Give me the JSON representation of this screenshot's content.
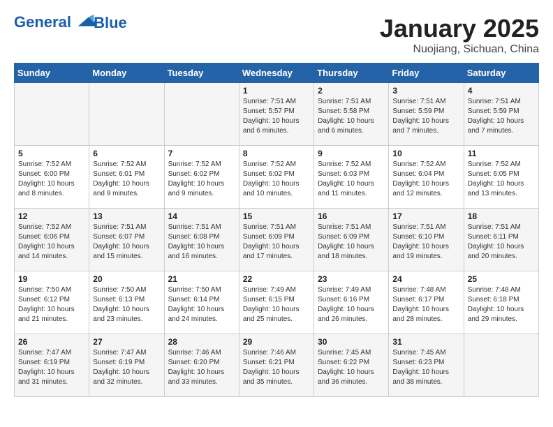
{
  "logo": {
    "line1": "General",
    "line2": "Blue"
  },
  "title": "January 2025",
  "subtitle": "Nuojiang, Sichuan, China",
  "days_of_week": [
    "Sunday",
    "Monday",
    "Tuesday",
    "Wednesday",
    "Thursday",
    "Friday",
    "Saturday"
  ],
  "weeks": [
    [
      {
        "day": "",
        "info": ""
      },
      {
        "day": "",
        "info": ""
      },
      {
        "day": "",
        "info": ""
      },
      {
        "day": "1",
        "info": "Sunrise: 7:51 AM\nSunset: 5:57 PM\nDaylight: 10 hours\nand 6 minutes."
      },
      {
        "day": "2",
        "info": "Sunrise: 7:51 AM\nSunset: 5:58 PM\nDaylight: 10 hours\nand 6 minutes."
      },
      {
        "day": "3",
        "info": "Sunrise: 7:51 AM\nSunset: 5:59 PM\nDaylight: 10 hours\nand 7 minutes."
      },
      {
        "day": "4",
        "info": "Sunrise: 7:51 AM\nSunset: 5:59 PM\nDaylight: 10 hours\nand 7 minutes."
      }
    ],
    [
      {
        "day": "5",
        "info": "Sunrise: 7:52 AM\nSunset: 6:00 PM\nDaylight: 10 hours\nand 8 minutes."
      },
      {
        "day": "6",
        "info": "Sunrise: 7:52 AM\nSunset: 6:01 PM\nDaylight: 10 hours\nand 9 minutes."
      },
      {
        "day": "7",
        "info": "Sunrise: 7:52 AM\nSunset: 6:02 PM\nDaylight: 10 hours\nand 9 minutes."
      },
      {
        "day": "8",
        "info": "Sunrise: 7:52 AM\nSunset: 6:02 PM\nDaylight: 10 hours\nand 10 minutes."
      },
      {
        "day": "9",
        "info": "Sunrise: 7:52 AM\nSunset: 6:03 PM\nDaylight: 10 hours\nand 11 minutes."
      },
      {
        "day": "10",
        "info": "Sunrise: 7:52 AM\nSunset: 6:04 PM\nDaylight: 10 hours\nand 12 minutes."
      },
      {
        "day": "11",
        "info": "Sunrise: 7:52 AM\nSunset: 6:05 PM\nDaylight: 10 hours\nand 13 minutes."
      }
    ],
    [
      {
        "day": "12",
        "info": "Sunrise: 7:52 AM\nSunset: 6:06 PM\nDaylight: 10 hours\nand 14 minutes."
      },
      {
        "day": "13",
        "info": "Sunrise: 7:51 AM\nSunset: 6:07 PM\nDaylight: 10 hours\nand 15 minutes."
      },
      {
        "day": "14",
        "info": "Sunrise: 7:51 AM\nSunset: 6:08 PM\nDaylight: 10 hours\nand 16 minutes."
      },
      {
        "day": "15",
        "info": "Sunrise: 7:51 AM\nSunset: 6:09 PM\nDaylight: 10 hours\nand 17 minutes."
      },
      {
        "day": "16",
        "info": "Sunrise: 7:51 AM\nSunset: 6:09 PM\nDaylight: 10 hours\nand 18 minutes."
      },
      {
        "day": "17",
        "info": "Sunrise: 7:51 AM\nSunset: 6:10 PM\nDaylight: 10 hours\nand 19 minutes."
      },
      {
        "day": "18",
        "info": "Sunrise: 7:51 AM\nSunset: 6:11 PM\nDaylight: 10 hours\nand 20 minutes."
      }
    ],
    [
      {
        "day": "19",
        "info": "Sunrise: 7:50 AM\nSunset: 6:12 PM\nDaylight: 10 hours\nand 21 minutes."
      },
      {
        "day": "20",
        "info": "Sunrise: 7:50 AM\nSunset: 6:13 PM\nDaylight: 10 hours\nand 23 minutes."
      },
      {
        "day": "21",
        "info": "Sunrise: 7:50 AM\nSunset: 6:14 PM\nDaylight: 10 hours\nand 24 minutes."
      },
      {
        "day": "22",
        "info": "Sunrise: 7:49 AM\nSunset: 6:15 PM\nDaylight: 10 hours\nand 25 minutes."
      },
      {
        "day": "23",
        "info": "Sunrise: 7:49 AM\nSunset: 6:16 PM\nDaylight: 10 hours\nand 26 minutes."
      },
      {
        "day": "24",
        "info": "Sunrise: 7:48 AM\nSunset: 6:17 PM\nDaylight: 10 hours\nand 28 minutes."
      },
      {
        "day": "25",
        "info": "Sunrise: 7:48 AM\nSunset: 6:18 PM\nDaylight: 10 hours\nand 29 minutes."
      }
    ],
    [
      {
        "day": "26",
        "info": "Sunrise: 7:47 AM\nSunset: 6:19 PM\nDaylight: 10 hours\nand 31 minutes."
      },
      {
        "day": "27",
        "info": "Sunrise: 7:47 AM\nSunset: 6:19 PM\nDaylight: 10 hours\nand 32 minutes."
      },
      {
        "day": "28",
        "info": "Sunrise: 7:46 AM\nSunset: 6:20 PM\nDaylight: 10 hours\nand 33 minutes."
      },
      {
        "day": "29",
        "info": "Sunrise: 7:46 AM\nSunset: 6:21 PM\nDaylight: 10 hours\nand 35 minutes."
      },
      {
        "day": "30",
        "info": "Sunrise: 7:45 AM\nSunset: 6:22 PM\nDaylight: 10 hours\nand 36 minutes."
      },
      {
        "day": "31",
        "info": "Sunrise: 7:45 AM\nSunset: 6:23 PM\nDaylight: 10 hours\nand 38 minutes."
      },
      {
        "day": "",
        "info": ""
      }
    ]
  ]
}
